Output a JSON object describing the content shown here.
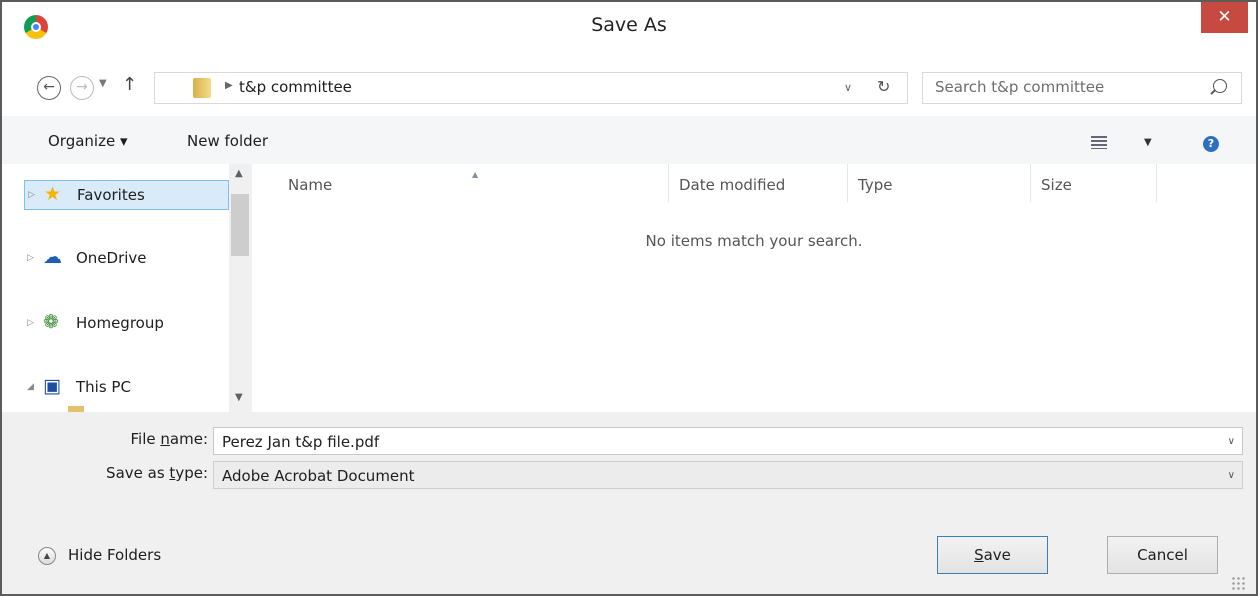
{
  "window": {
    "title": "Save As",
    "close_glyph": "✕"
  },
  "address": {
    "breadcrumb": "t&p committee",
    "search_placeholder": "Search t&p committee"
  },
  "toolbar": {
    "organize_label": "Organize ▾",
    "new_folder_label": "New folder",
    "help_glyph": "?"
  },
  "nav": {
    "items": [
      {
        "label": "Favorites",
        "icon": "star-icon",
        "selected": true
      },
      {
        "label": "OneDrive",
        "icon": "cloud-icon"
      },
      {
        "label": "Homegroup",
        "icon": "homegroup-icon"
      },
      {
        "label": "This PC",
        "icon": "computer-icon",
        "expanded": true
      }
    ]
  },
  "file_list": {
    "columns": [
      "Name",
      "Date modified",
      "Type",
      "Size"
    ],
    "sorted_by": "Name",
    "empty_message": "No items match your search."
  },
  "form": {
    "file_name_label_pre": "File ",
    "file_name_label_key": "n",
    "file_name_label_post": "ame:",
    "file_name_value": "Perez Jan t&p file.pdf",
    "save_type_label_pre": "Save as ",
    "save_type_label_key": "t",
    "save_type_label_post": "ype:",
    "save_type_value": "Adobe Acrobat Document"
  },
  "footer": {
    "hide_folders_label": "Hide Folders",
    "save_key": "S",
    "save_rest": "ave",
    "cancel_label": "Cancel"
  },
  "colors": {
    "close_button": "#c74a41",
    "selection_fill": "#d9ebf9",
    "selection_border": "#7ec1ec",
    "default_button_border": "#3c7fb1"
  }
}
